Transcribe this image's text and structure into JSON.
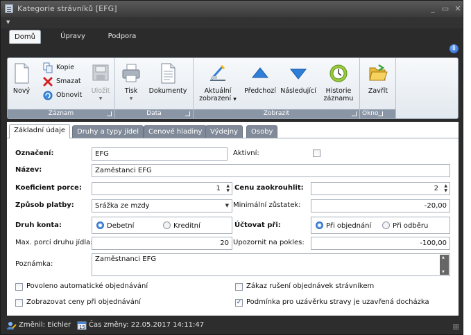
{
  "window": {
    "title": "Kategorie strávníků [EFG]"
  },
  "ribbon_tabs": [
    "Domů",
    "Úpravy",
    "Podpora"
  ],
  "ribbon": {
    "zaznam": {
      "label": "Záznam",
      "novy": "Nový",
      "kopie": "Kopie",
      "smazat": "Smazat",
      "obnovit": "Obnovit",
      "ulozit": "Uložit"
    },
    "data": {
      "label": "Data",
      "tisk": "Tisk",
      "dokumenty": "Dokumenty"
    },
    "zobrazit": {
      "label": "Zobrazit",
      "aktualni_line1": "Aktuální",
      "aktualni_line2": "zobrazení",
      "predchozi": "Předchozí",
      "nasledujici": "Následující",
      "historie_line1": "Historie",
      "historie_line2": "záznamu"
    },
    "okno": {
      "label": "Okno",
      "zavrit": "Zavřít"
    }
  },
  "content_tabs": [
    "Základní údaje",
    "Druhy a typy jídel",
    "Cenové hladiny",
    "Výdejny",
    "Osoby"
  ],
  "form": {
    "oznaceni": {
      "label": "Označení:",
      "value": "EFG"
    },
    "aktivni": {
      "label": "Aktivní:",
      "checked": false
    },
    "nazev": {
      "label": "Název:",
      "value": "Zaměstanci EFG"
    },
    "koeficient": {
      "label": "Koeficient porce:",
      "value": "1"
    },
    "cena_zaokrouhlit": {
      "label": "Cenu zaokrouhlit:",
      "value": "2"
    },
    "zpusob_platby": {
      "label": "Způsob platby:",
      "value": "Srážka ze mzdy"
    },
    "min_zustatek": {
      "label": "Minimální zůstatek:",
      "value": "-20,00"
    },
    "druh_konta": {
      "label": "Druh konta:",
      "options": [
        "Debetní",
        "Kreditní"
      ],
      "selected": "Debetní"
    },
    "uctovat_pri": {
      "label": "Účtovat při:",
      "options": [
        "Při objednání",
        "Při odběru"
      ],
      "selected": "Při objednání"
    },
    "max_porci": {
      "label": "Max. porcí druhu jídla:",
      "value": "20"
    },
    "upozornit": {
      "label": "Upozornit na pokles:",
      "value": "-100,00"
    },
    "poznamka": {
      "label": "Poznámka:",
      "value": "Zaměstnanci EFG"
    },
    "checkboxes": [
      {
        "label": "Povoleno automatické objednávání",
        "checked": false
      },
      {
        "label": "Zákaz rušení objednávek strávníkem",
        "checked": false
      },
      {
        "label": "Zobrazovat ceny při objednávání",
        "checked": false
      },
      {
        "label": "Podmínka pro uzávěrku stravy je uzavřená docházka",
        "checked": true
      }
    ]
  },
  "status": {
    "changed_by": "Změnil: Eichler",
    "changed_time": "Čas změny: 22.05.2017 14:11:47"
  }
}
